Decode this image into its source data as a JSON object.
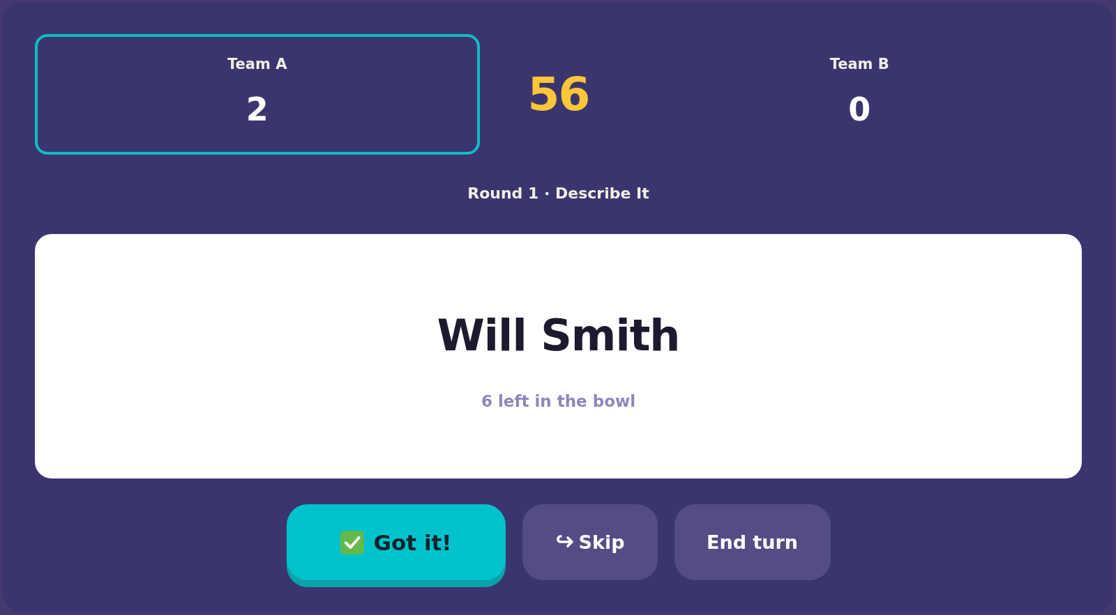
{
  "teams": [
    {
      "name": "Team A",
      "score": "2",
      "selected": true
    },
    {
      "name": "Team B",
      "score": "0",
      "selected": false
    }
  ],
  "timer": "56",
  "round_label": "Round 1 · Describe It",
  "card": {
    "word": "Will Smith",
    "remaining": "6 left in the bowl"
  },
  "buttons": [
    {
      "label": "Got it!",
      "kind": "confirm"
    },
    {
      "label": "Skip",
      "kind": "skip"
    },
    {
      "label": "End turn",
      "kind": "end"
    }
  ]
}
